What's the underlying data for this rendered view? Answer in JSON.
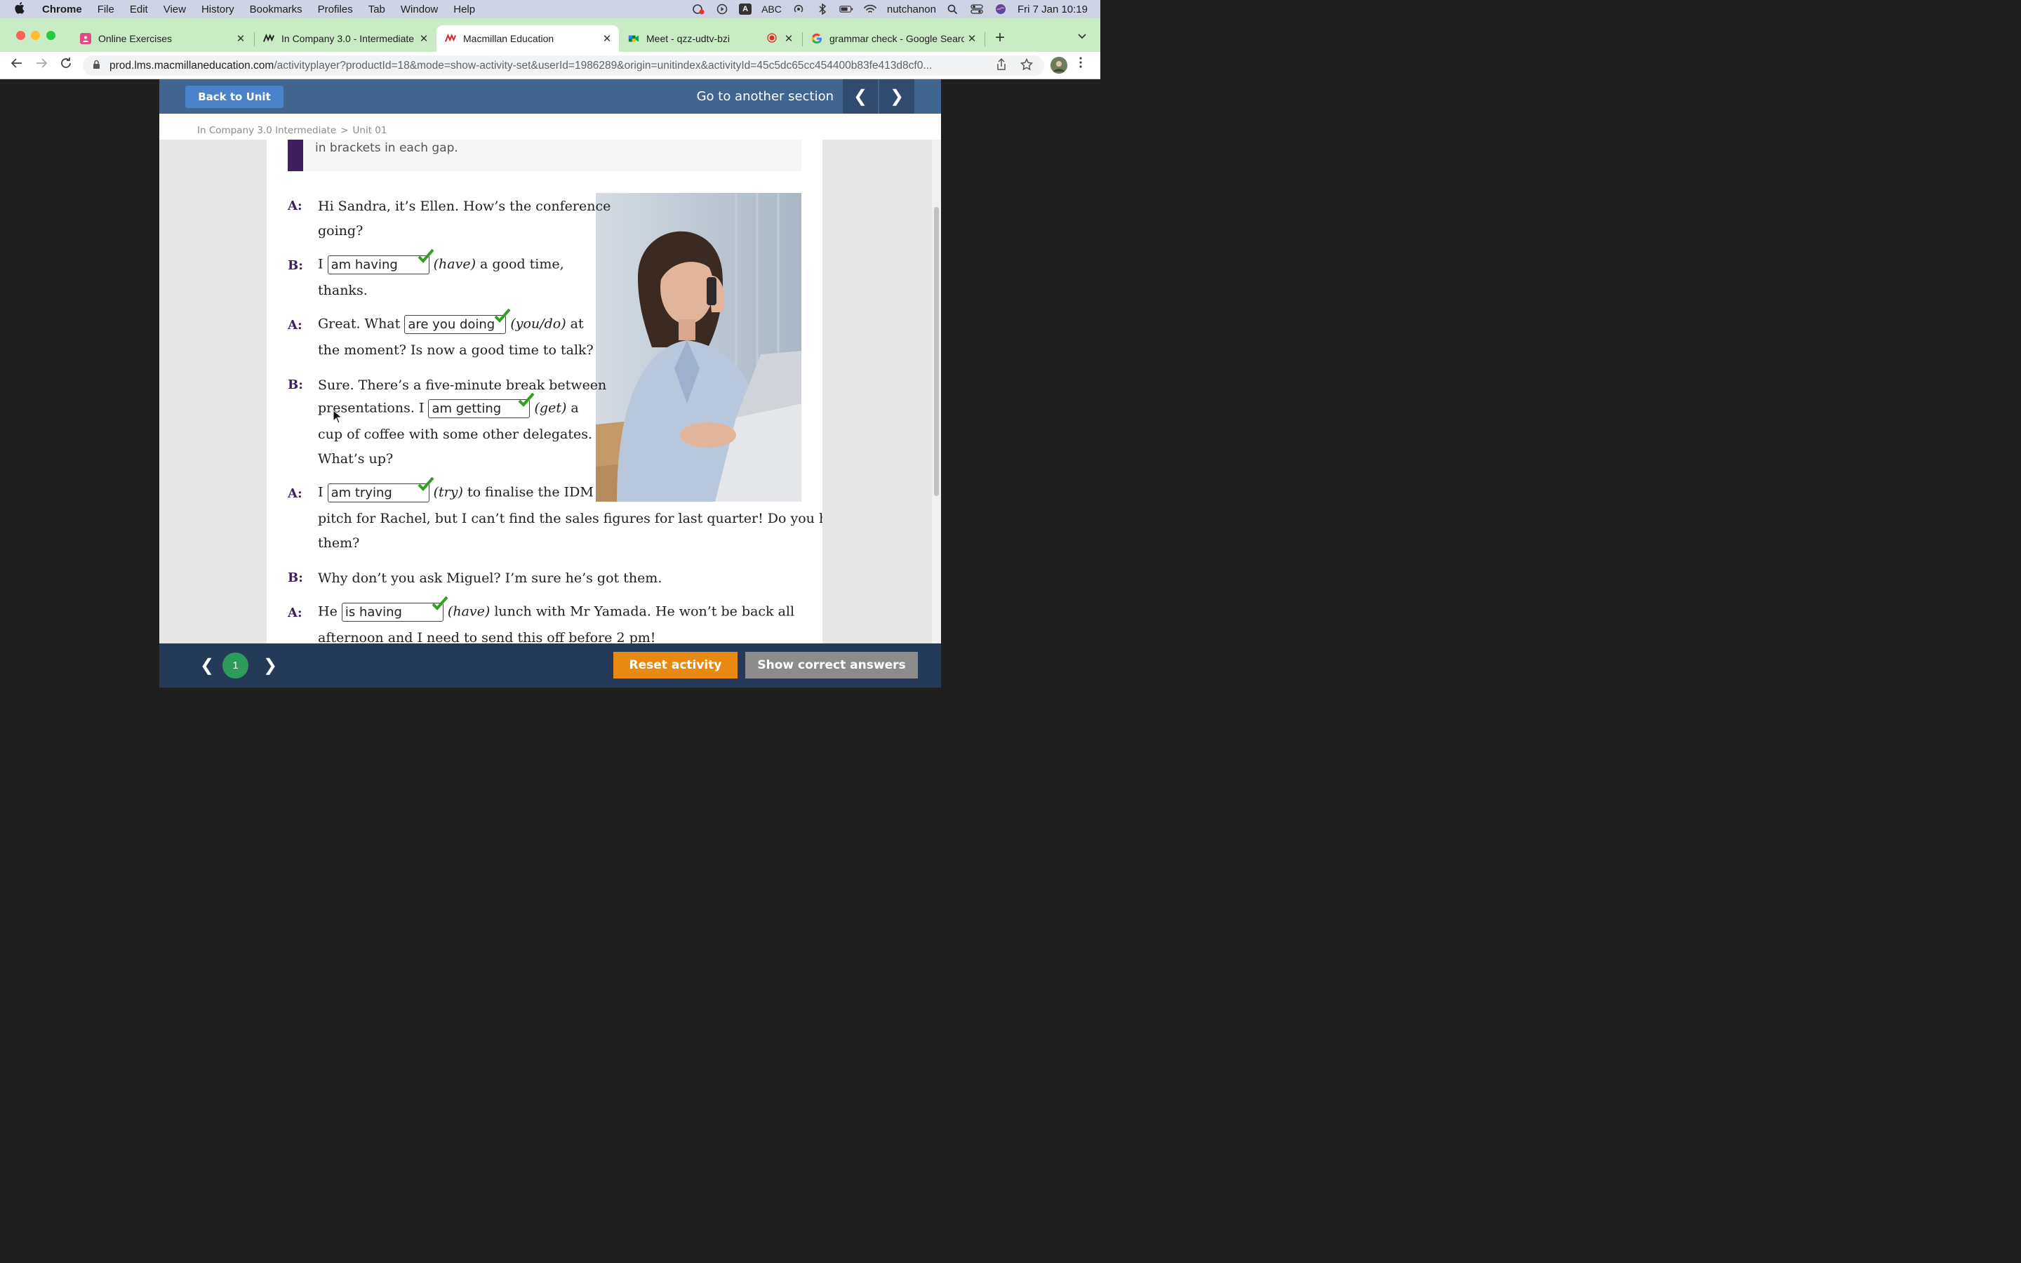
{
  "menubar": {
    "app": "Chrome",
    "items": [
      "File",
      "Edit",
      "View",
      "History",
      "Bookmarks",
      "Profiles",
      "Tab",
      "Window",
      "Help"
    ],
    "input_source": "ABC",
    "user": "nutchanon",
    "datetime": "Fri 7 Jan  10:19"
  },
  "tabs": [
    {
      "title": "Online Exercises",
      "close": "✕"
    },
    {
      "title": "In Company 3.0 - Intermediate",
      "close": "✕"
    },
    {
      "title": "Macmillan Education",
      "close": "✕"
    },
    {
      "title": "Meet - qzz-udtv-bzi",
      "close": "✕"
    },
    {
      "title": "grammar check - Google Search",
      "close": "✕"
    }
  ],
  "address": {
    "host": "prod.lms.macmillaneducation.com",
    "path": "/activityplayer?productId=18&mode=show-activity-set&userId=1986289&origin=unitindex&activityId=45c5dc65cc454400b83fe413d8cf0..."
  },
  "header": {
    "back_label": "Back to Unit",
    "goto_label": "Go to another section",
    "prev_arrow": "❮",
    "next_arrow": "❯"
  },
  "breadcrumb": {
    "course": "In Company 3.0 Intermediate",
    "separator": ">",
    "unit": "Unit 01"
  },
  "rubric": "in brackets in each gap.",
  "dialogue": {
    "l1": {
      "speaker": "A:",
      "text": "Hi Sandra, it’s Ellen. How’s the conference"
    },
    "l1b": "going?",
    "l2": {
      "speaker": "B:",
      "pre": "I",
      "answer": "am having",
      "verb": "(have)",
      "post": "a good time,"
    },
    "l2b": "thanks.",
    "l3": {
      "speaker": "A:",
      "pre": "Great. What",
      "answer": "are you doing",
      "verb": "(you/do)",
      "post": "at"
    },
    "l3b": "the moment? Is now a good time to talk?",
    "l4": {
      "speaker": "B:",
      "text": "Sure. There’s a five-minute break between"
    },
    "l4b": {
      "pre": "presentations. I",
      "answer": "am getting",
      "verb": "(get)",
      "post": "a"
    },
    "l4c": "cup of coffee with some other delegates.",
    "l4d": "What’s up?",
    "l5": {
      "speaker": "A:",
      "pre": "I",
      "answer": "am trying",
      "verb": "(try)",
      "post": "to finalise the IDM"
    },
    "l5b": "pitch for Rachel, but I can’t find the sales figures for last quarter! Do you have",
    "l5c": "them?",
    "l6": {
      "speaker": "B:",
      "text": "Why don’t you ask Miguel? I’m sure he’s got them."
    },
    "l7": {
      "speaker": "A:",
      "pre": "He",
      "answer": "is having",
      "verb": "(have)",
      "post": "lunch with Mr Yamada. He won’t be back all"
    },
    "l7b": "afternoon and I need to send this off before 2 pm!"
  },
  "footer": {
    "prev_arrow": "❮",
    "page": "1",
    "next_arrow": "❯",
    "reset_label": "Reset activity",
    "show_label": "Show correct answers"
  },
  "colors": {
    "header_blue": "#3f6590",
    "footer_navy": "#253a58",
    "speaker_purple": "#3c1f5c",
    "reset_orange": "#e88a12",
    "correct_green": "#2fa01f"
  }
}
